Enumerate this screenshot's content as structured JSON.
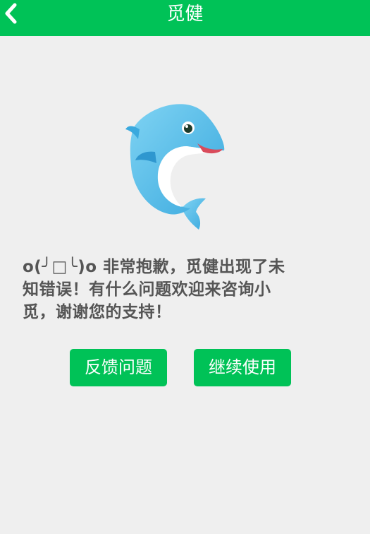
{
  "header": {
    "title": "觅健",
    "back_icon": "chevron-left-icon"
  },
  "mascot": {
    "icon": "dolphin-mascot"
  },
  "error": {
    "line1": "o(╯□╰)o  非常抱歉，觅健出现了未",
    "line2": "知错误！有什么问题欢迎来咨询小",
    "line3": "觅，谢谢您的支持！"
  },
  "actions": {
    "feedback_label": "反馈问题",
    "continue_label": "继续使用"
  },
  "colors": {
    "accent": "#00c257",
    "background": "#efefef",
    "text": "#555555"
  }
}
